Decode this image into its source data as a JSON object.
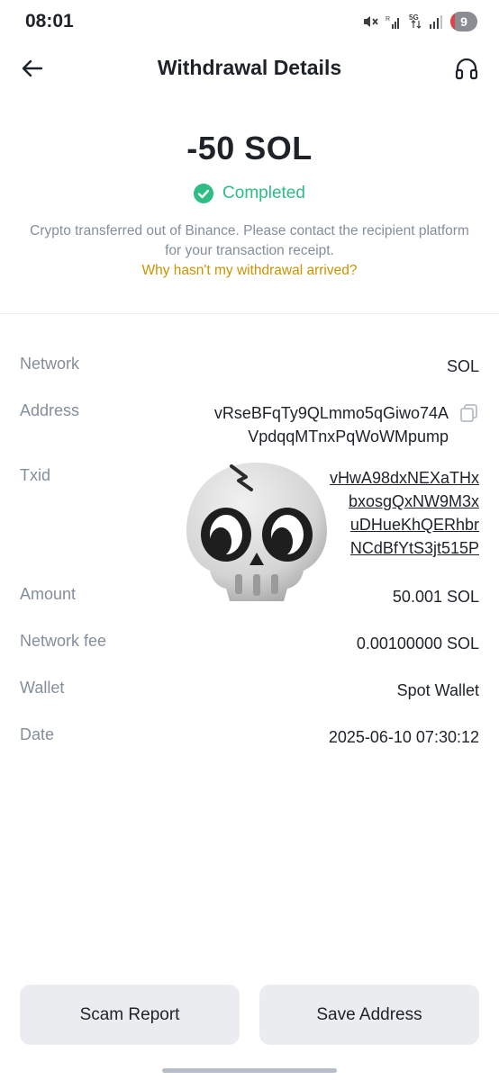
{
  "status_bar": {
    "time": "08:01",
    "battery_level": "9",
    "network_label": "5G",
    "icons": [
      "mute-icon",
      "signal-icon",
      "network-5g-icon",
      "signal-icon",
      "battery-icon"
    ]
  },
  "header": {
    "title": "Withdrawal Details",
    "back_icon": "arrow-left-icon",
    "support_icon": "headset-icon"
  },
  "summary": {
    "amount": "-50 SOL",
    "status": "Completed",
    "status_color": "#2ebd85",
    "note": "Crypto transferred out of Binance. Please contact the recipient platform for your transaction receipt.",
    "help_link": "Why hasn't my withdrawal arrived?",
    "link_color": "#c99400"
  },
  "details": {
    "network": {
      "label": "Network",
      "value": "SOL"
    },
    "address": {
      "label": "Address",
      "line1": "vRseBFqTy9QLmmo5qGiwo74A",
      "line2": "VpdqqMTnxPqWoWMpump"
    },
    "txid": {
      "label": "Txid",
      "lines": [
        "vHwA98dxNEXaTHx",
        "bxosgQxNW9M3x",
        "uDHueKhQERhbr",
        "NCdBfYtS3jt515P"
      ]
    },
    "amount": {
      "label": "Amount",
      "value": "50.001 SOL"
    },
    "fee": {
      "label": "Network fee",
      "value": "0.00100000 SOL"
    },
    "wallet": {
      "label": "Wallet",
      "value": "Spot Wallet"
    },
    "date": {
      "label": "Date",
      "value": "2025-06-10 07:30:12"
    }
  },
  "overlay": {
    "icon": "skull-emoji-icon"
  },
  "actions": {
    "scam_report": "Scam Report",
    "save_address": "Save Address"
  }
}
